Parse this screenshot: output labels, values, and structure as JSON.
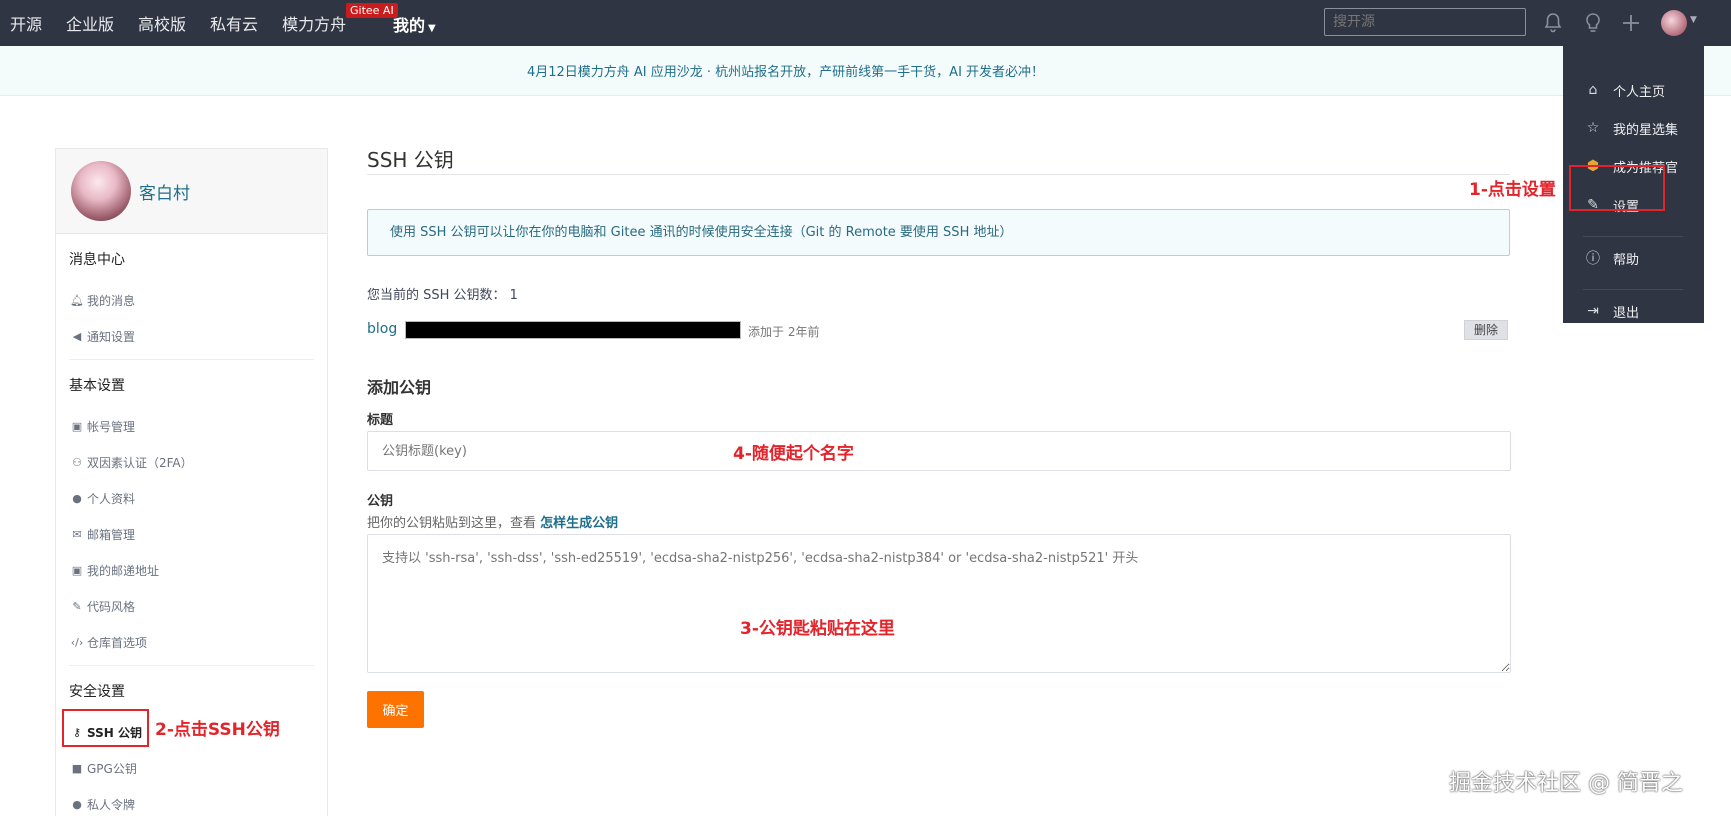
{
  "topnav": {
    "items": [
      "开源",
      "企业版",
      "高校版",
      "私有云",
      "模力方舟"
    ],
    "badge": "Gitee AI",
    "mine": "我的",
    "search_placeholder": "搜开源"
  },
  "banner": {
    "text": "4月12日模力方舟 AI 应用沙龙 · 杭州站报名开放，产研前线第一手干货，AI 开发者必冲！"
  },
  "profile": {
    "name": "客白村"
  },
  "sidebar": {
    "sections": [
      {
        "title": "消息中心",
        "items": [
          "我的消息",
          "通知设置"
        ]
      },
      {
        "title": "基本设置",
        "items": [
          "帐号管理",
          "双因素认证（2FA）",
          "个人资料",
          "邮箱管理",
          "我的邮递地址",
          "代码风格",
          "仓库首选项"
        ]
      },
      {
        "title": "安全设置",
        "items": [
          "SSH 公钥",
          "GPG公钥",
          "私人令牌"
        ]
      }
    ]
  },
  "main": {
    "title": "SSH 公钥",
    "info": "使用 SSH 公钥可以让你在你的电脑和 Gitee 通讯的时候使用安全连接（Git 的 Remote 要使用 SSH 地址）",
    "count_label": "您当前的 SSH 公钥数： 1",
    "key": {
      "name": "blog",
      "added": "添加于 2年前",
      "delete": "删除"
    },
    "add_title": "添加公钥",
    "title_label": "标题",
    "title_placeholder": "公钥标题(key)",
    "key_label": "公钥",
    "hint_prefix": "把你的公钥粘贴到这里，查看",
    "hint_link": "怎样生成公钥",
    "key_placeholder": "支持以 'ssh-rsa', 'ssh-dss', 'ssh-ed25519', 'ecdsa-sha2-nistp256', 'ecdsa-sha2-nistp384' or 'ecdsa-sha2-nistp521' 开头",
    "confirm": "确定"
  },
  "dropdown": {
    "items": [
      "个人主页",
      "我的星选集",
      "成为推荐官",
      "设置",
      "帮助",
      "退出"
    ]
  },
  "annotations": {
    "a1": "1-点击设置",
    "a2": "2-点击SSH公钥",
    "a3": "3-公钥匙粘贴在这里",
    "a4": "4-随便起个名字"
  },
  "watermark": "掘金技术社区 @ 简晋之",
  "colors": {
    "nav_bg": "#2f3542",
    "accent": "#fe7300",
    "link": "#1f6f8b",
    "annotation": "#e3242b"
  }
}
